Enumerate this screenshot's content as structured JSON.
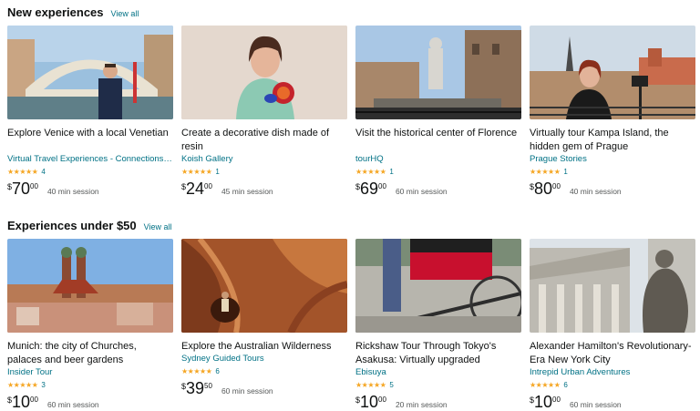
{
  "sections": [
    {
      "title": "New experiences",
      "view_all": "View all",
      "cards": [
        {
          "title": "Explore Venice with a local Venetian",
          "provider": "Virtual Travel Experiences - Connections…",
          "stars": "★★★★★",
          "reviews": "4",
          "currency": "$",
          "price_whole": "70",
          "price_cents": "00",
          "session": "40 min session",
          "image": "venice-bridge-host"
        },
        {
          "title": "Create a decorative dish made of resin",
          "provider": "Koish Gallery",
          "stars": "★★★★★",
          "reviews": "1",
          "currency": "$",
          "price_whole": "24",
          "price_cents": "00",
          "session": "45 min session",
          "image": "resin-dish-host"
        },
        {
          "title": "Visit the historical center of Florence",
          "provider": "tourHQ",
          "stars": "★★★★★",
          "reviews": "1",
          "currency": "$",
          "price_whole": "69",
          "price_cents": "00",
          "session": "60 min session",
          "image": "florence-fountain"
        },
        {
          "title": "Virtually tour Kampa Island, the hidden gem of Prague",
          "provider": "Prague Stories",
          "stars": "★★★★★",
          "reviews": "1",
          "currency": "$",
          "price_whole": "80",
          "price_cents": "00",
          "session": "40 min session",
          "image": "prague-host-camera"
        }
      ]
    },
    {
      "title": "Experiences under $50",
      "view_all": "View all",
      "cards": [
        {
          "title": "Munich: the city of Churches, palaces and beer gardens",
          "provider": "Insider Tour",
          "stars": "★★★★★",
          "reviews": "3",
          "currency": "$",
          "price_whole": "10",
          "price_cents": "00",
          "session": "60 min session",
          "image": "munich-skyline"
        },
        {
          "title": "Explore the Australian Wilderness",
          "provider": "Sydney Guided Tours",
          "stars": "★★★★★",
          "reviews": "6",
          "currency": "$",
          "price_whole": "39",
          "price_cents": "50",
          "session": "60 min session",
          "image": "australian-rock-cave"
        },
        {
          "title": "Rickshaw Tour Through Tokyo's Asakusa: Virtually upgraded",
          "provider": "Ebisuya",
          "stars": "★★★★★",
          "reviews": "5",
          "currency": "$",
          "price_whole": "10",
          "price_cents": "00",
          "session": "20 min session",
          "image": "tokyo-rickshaw"
        },
        {
          "title": "Alexander Hamilton's Revolutionary-Era New York City",
          "provider": "Intrepid Urban Adventures",
          "stars": "★★★★★",
          "reviews": "6",
          "currency": "$",
          "price_whole": "10",
          "price_cents": "00",
          "session": "60 min session",
          "image": "nyc-statue"
        }
      ]
    }
  ]
}
